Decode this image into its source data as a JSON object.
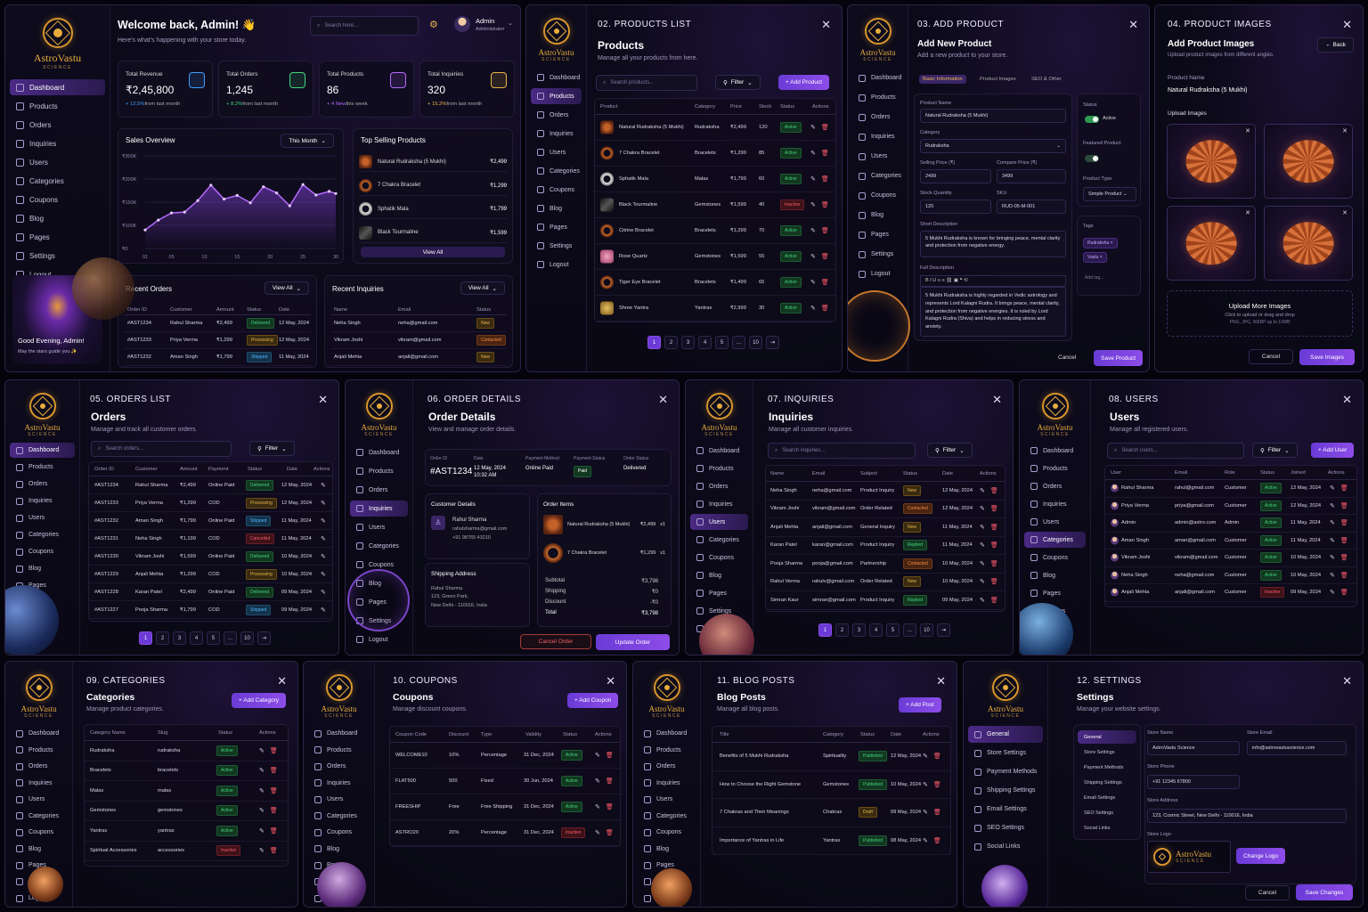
{
  "brand": {
    "name": "AstroVastu",
    "sub": "SCIENCE"
  },
  "nav": [
    "Dashboard",
    "Products",
    "Orders",
    "Inquiries",
    "Users",
    "Categories",
    "Coupons",
    "Blog",
    "Pages",
    "Settings",
    "Logout"
  ],
  "dash": {
    "welcome": "Welcome back, Admin! 👋",
    "tagline": "Here's what's happening with your store today.",
    "search": "Search here...",
    "user": "Admin",
    "role": "Administrator",
    "stats": [
      {
        "label": "Total Revenue",
        "value": "₹2,45,800",
        "delta": "+ 12.5%",
        "note": "from last month",
        "color": "#3fa0ff"
      },
      {
        "label": "Total Orders",
        "value": "1,245",
        "delta": "+ 8.2%",
        "note": "from last month",
        "color": "#3fd77b"
      },
      {
        "label": "Total Products",
        "value": "86",
        "delta": "+ 4 New",
        "note": "this week",
        "color": "#b36bff"
      },
      {
        "label": "Total Inquiries",
        "value": "320",
        "delta": "+ 15.2%",
        "note": "from last month",
        "color": "#e8b54a"
      }
    ],
    "sales": {
      "title": "Sales Overview",
      "range": "This Month"
    },
    "top": {
      "title": "Top Selling Products",
      "items": [
        {
          "name": "Natural Rudraksha (5 Mukhi)",
          "price": "₹2,499"
        },
        {
          "name": "7 Chakra Bracelet",
          "price": "₹1,299"
        },
        {
          "name": "Sphatik Mala",
          "price": "₹1,799"
        },
        {
          "name": "Black Tourmaline",
          "price": "₹1,599"
        }
      ],
      "view": "View All"
    },
    "recent_orders": {
      "title": "Recent Orders",
      "view": "View All",
      "cols": [
        "Order ID",
        "Customer",
        "Amount",
        "Status",
        "Date"
      ],
      "rows": [
        [
          "#AST1234",
          "Rahul Sharma",
          "₹2,499",
          "Delivered",
          "12 May, 2024"
        ],
        [
          "#AST1233",
          "Priya Verma",
          "₹1,299",
          "Processing",
          "12 May, 2024"
        ],
        [
          "#AST1232",
          "Aman Singh",
          "₹1,799",
          "Shipped",
          "11 May, 2024"
        ]
      ]
    },
    "recent_inq": {
      "title": "Recent Inquiries",
      "view": "View All",
      "cols": [
        "Name",
        "Email",
        "Status"
      ],
      "rows": [
        [
          "Neha Singh",
          "neha@gmail.com",
          "New"
        ],
        [
          "Vikram Joshi",
          "vikram@gmail.com",
          "Contacted"
        ],
        [
          "Anjali Mehta",
          "anjali@gmail.com",
          "New"
        ]
      ]
    },
    "greet": "Good Evening, Admin!",
    "greet_sub": "May the stars guide you ✨"
  },
  "chart_data": {
    "type": "area",
    "x": [
      1,
      3,
      5,
      7,
      9,
      11,
      13,
      15,
      17,
      19,
      21,
      23,
      25,
      27,
      29,
      30
    ],
    "values": [
      60,
      92,
      115,
      118,
      155,
      205,
      160,
      172,
      148,
      200,
      180,
      138,
      207,
      173,
      185,
      178
    ],
    "ylim": [
      0,
      300
    ],
    "xticks": [
      "01",
      "05",
      "10",
      "15",
      "20",
      "25",
      "30"
    ],
    "yticks": [
      "₹300K",
      "₹200K",
      "₹150K",
      "₹100K",
      "₹0"
    ]
  },
  "p02": {
    "title": "02. PRODUCTS LIST",
    "h": "Products",
    "sub": "Manage all your products from here.",
    "search": "Search products...",
    "filter": "Filter",
    "add": "+ Add Product",
    "cols": [
      "Product",
      "Category",
      "Price",
      "Stock",
      "Status",
      "Actions"
    ],
    "rows": [
      [
        "Natural Rudraksha (5 Mukhi)",
        "Rudraksha",
        "₹2,499",
        "120",
        "Active",
        "rudra"
      ],
      [
        "7 Chakra Bracelet",
        "Bracelets",
        "₹1,299",
        "85",
        "Active",
        "ring"
      ],
      [
        "Sphatik Mala",
        "Malas",
        "₹1,799",
        "60",
        "Active",
        "white"
      ],
      [
        "Black Tourmaline",
        "Gemstones",
        "₹1,599",
        "40",
        "Inactive",
        "black"
      ],
      [
        "Citrine Bracelet",
        "Bracelets",
        "₹1,299",
        "70",
        "Active",
        "ring"
      ],
      [
        "Rose Quartz",
        "Gemstones",
        "₹1,599",
        "55",
        "Active",
        "pink"
      ],
      [
        "Tiger Eye Bracelet",
        "Bracelets",
        "₹1,499",
        "65",
        "Active",
        "ring"
      ],
      [
        "Shree Yantra",
        "Yantras",
        "₹2,999",
        "30",
        "Active",
        "gold"
      ]
    ],
    "pages": [
      "1",
      "2",
      "3",
      "4",
      "5",
      "...",
      "10",
      "⇥"
    ]
  },
  "p03": {
    "title": "03. ADD PRODUCT",
    "h": "Add New Product",
    "sub": "Add a new product to your store.",
    "tabs": [
      "Basic Information",
      "Product Images",
      "SEO & Other"
    ],
    "fields": {
      "name_l": "Product Name",
      "name": "Natural Rudraksha (5 Mukhi)",
      "cat_l": "Category",
      "cat": "Rudraksha",
      "sp_l": "Selling Price (₹)",
      "sp": "2499",
      "cp_l": "Compare Price (₹)",
      "cp": "3499",
      "stock_l": "Stock Quantity",
      "stock": "120",
      "sku_l": "SKU",
      "sku": "RUD-05-M-001",
      "short_l": "Short Description",
      "short": "5 Mukhi Rudraksha is known for bringing peace, mental clarity and protection from negative energy.",
      "full_l": "Full Description",
      "full": "5 Mukhi Rudraksha is highly regarded in Vedic astrology and represents Lord Kalagni Rudra. It brings peace, mental clarity, and protection from negative energies. It is ruled by Lord Kalagni Rudra (Shiva) and helps in reducing stress and anxiety."
    },
    "status_l": "Status",
    "status": "Active",
    "featured_l": "Featured Product",
    "type_l": "Product Type",
    "type": "Simple Product",
    "tags_l": "Tags",
    "tags": [
      "Rudraksha ×",
      "Vastu ×"
    ],
    "tag_ph": "Add tag...",
    "cancel": "Cancel",
    "save": "Save Product"
  },
  "p04": {
    "title": "04. PRODUCT IMAGES",
    "back": "← Back",
    "h": "Add Product Images",
    "sub": "Upload product images from different angles.",
    "name_l": "Product Name",
    "name": "Natural Rudraksha (5 Mukhi)",
    "upload_l": "Upload Images",
    "more": "Upload More Images",
    "more_sub": "Click to upload or drag and drop",
    "fmt": "PNG, JPG, WEBP up to 10MB",
    "cancel": "Cancel",
    "save": "Save Images"
  },
  "p05": {
    "title": "05. ORDERS LIST",
    "h": "Orders",
    "sub": "Manage and track all customer orders.",
    "search": "Search orders...",
    "filter": "Filter",
    "cols": [
      "Order ID",
      "Customer",
      "Amount",
      "Payment",
      "Status",
      "Date",
      "Actions"
    ],
    "rows": [
      [
        "#AST1234",
        "Rahul Sharma",
        "₹2,499",
        "Online Paid",
        "Delivered",
        "12 May, 2024"
      ],
      [
        "#AST1233",
        "Priya Verma",
        "₹1,299",
        "COD",
        "Processing",
        "12 May, 2024"
      ],
      [
        "#AST1232",
        "Aman Singh",
        "₹1,799",
        "Online Paid",
        "Shipped",
        "11 May, 2024"
      ],
      [
        "#AST1231",
        "Neha Singh",
        "₹1,199",
        "COD",
        "Cancelled",
        "11 May, 2024"
      ],
      [
        "#AST1230",
        "Vikram Joshi",
        "₹1,599",
        "Online Paid",
        "Delivered",
        "10 May, 2024"
      ],
      [
        "#AST1229",
        "Anjali Mehta",
        "₹1,299",
        "COD",
        "Processing",
        "10 May, 2024"
      ],
      [
        "#AST1228",
        "Karan Patel",
        "₹2,499",
        "Online Paid",
        "Delivered",
        "09 May, 2024"
      ],
      [
        "#AST1227",
        "Pooja Sharma",
        "₹1,799",
        "COD",
        "Shipped",
        "09 May, 2024"
      ]
    ],
    "pages": [
      "1",
      "2",
      "3",
      "4",
      "5",
      "...",
      "10",
      "⇥"
    ]
  },
  "p06": {
    "title": "06. ORDER DETAILS",
    "h": "Order Details",
    "sub": "View and manage order details.",
    "summary": [
      [
        "Order ID",
        "#AST1234"
      ],
      [
        "Date",
        "12 May, 2024\n10:32 AM"
      ],
      [
        "Payment Method",
        "Online Paid"
      ],
      [
        "Payment Status",
        "Paid"
      ],
      [
        "Order Status",
        "Delivered"
      ]
    ],
    "cust_t": "Customer Details",
    "cust_name": "Rahul Sharma",
    "cust_email": "rahulsharma@gmail.com",
    "cust_phone": "+91 98765 43210",
    "items_t": "Order Items",
    "items": [
      [
        "Natural Rudraksha (5 Mukhi)",
        "₹2,499",
        "x1"
      ],
      [
        "7 Chakra Bracelet",
        "₹1,299",
        "x1"
      ]
    ],
    "ship_t": "Shipping Address",
    "ship": [
      "Rahul Sharma",
      "123, Green Park,",
      "New Delhi - 110016, India"
    ],
    "totals": [
      [
        "Subtotal",
        "₹3,798"
      ],
      [
        "Shipping",
        "₹0"
      ],
      [
        "Discount",
        "-₹0"
      ],
      [
        "Total",
        "₹3,798"
      ]
    ],
    "cancel": "Cancel Order",
    "update": "Update Order"
  },
  "p07": {
    "title": "07. INQUIRIES",
    "h": "Inquiries",
    "sub": "Manage all customer inquiries.",
    "search": "Search inquiries...",
    "filter": "Filter",
    "cols": [
      "Name",
      "Email",
      "Subject",
      "Status",
      "Date",
      "Actions"
    ],
    "rows": [
      [
        "Neha Singh",
        "neha@gmail.com",
        "Product Inquiry",
        "New",
        "12 May, 2024"
      ],
      [
        "Vikram Joshi",
        "vikram@gmail.com",
        "Order Related",
        "Contacted",
        "12 May, 2024"
      ],
      [
        "Anjali Mehta",
        "anjali@gmail.com",
        "General Inquiry",
        "New",
        "11 May, 2024"
      ],
      [
        "Karan Patel",
        "karan@gmail.com",
        "Product Inquiry",
        "Replied",
        "11 May, 2024"
      ],
      [
        "Pooja Sharma",
        "pooja@gmail.com",
        "Partnership",
        "Contacted",
        "10 May, 2024"
      ],
      [
        "Rahul Verma",
        "rahulv@gmail.com",
        "Order Related",
        "New",
        "10 May, 2024"
      ],
      [
        "Simran Kaur",
        "simran@gmail.com",
        "Product Inquiry",
        "Replied",
        "09 May, 2024"
      ]
    ],
    "pages": [
      "1",
      "2",
      "3",
      "4",
      "5",
      "...",
      "10",
      "⇥"
    ]
  },
  "p08": {
    "title": "08. USERS",
    "h": "Users",
    "sub": "Manage all registered users.",
    "search": "Search users...",
    "filter": "Filter",
    "add": "+ Add User",
    "cols": [
      "User",
      "Email",
      "Role",
      "Status",
      "Joined",
      "Actions"
    ],
    "rows": [
      [
        "Rahul Sharma",
        "rahul@gmail.com",
        "Customer",
        "Active",
        "12 May, 2024"
      ],
      [
        "Priya Verma",
        "priya@gmail.com",
        "Customer",
        "Active",
        "12 May, 2024"
      ],
      [
        "Admin",
        "admin@astro.com",
        "Admin",
        "Active",
        "11 May, 2024"
      ],
      [
        "Aman Singh",
        "aman@gmail.com",
        "Customer",
        "Active",
        "11 May, 2024"
      ],
      [
        "Vikram Joshi",
        "vikram@gmail.com",
        "Customer",
        "Active",
        "10 May, 2024"
      ],
      [
        "Neha Singh",
        "neha@gmail.com",
        "Customer",
        "Active",
        "10 May, 2024"
      ],
      [
        "Anjali Mehta",
        "anjali@gmail.com",
        "Customer",
        "Inactive",
        "09 May, 2024"
      ]
    ]
  },
  "p09": {
    "title": "09. CATEGORIES",
    "h": "Categories",
    "sub": "Manage product categories.",
    "add": "+ Add Category",
    "cols": [
      "Category Name",
      "Slug",
      "Status",
      "Actions"
    ],
    "rows": [
      [
        "Rudraksha",
        "rudraksha",
        "Active"
      ],
      [
        "Bracelets",
        "bracelets",
        "Active"
      ],
      [
        "Malas",
        "malas",
        "Active"
      ],
      [
        "Gemstones",
        "gemstones",
        "Active"
      ],
      [
        "Yantras",
        "yantras",
        "Active"
      ],
      [
        "Spiritual Accessories",
        "accessories",
        "Inactive"
      ]
    ]
  },
  "p10": {
    "title": "10. COUPONS",
    "h": "Coupons",
    "sub": "Manage discount coupons.",
    "add": "+ Add Coupon",
    "cols": [
      "Coupon Code",
      "Discount",
      "Type",
      "Validity",
      "Status",
      "Actions"
    ],
    "rows": [
      [
        "WELCOME10",
        "10%",
        "Percentage",
        "31 Dec, 2024",
        "Active"
      ],
      [
        "FLAT500",
        "500",
        "Fixed",
        "30 Jun, 2024",
        "Active"
      ],
      [
        "FREESHIP",
        "Free",
        "Free Shipping",
        "31 Dec, 2024",
        "Active"
      ],
      [
        "ASTRO20",
        "20%",
        "Percentage",
        "31 Dec, 2024",
        "Inactive"
      ]
    ]
  },
  "p11": {
    "title": "11. BLOG POSTS",
    "h": "Blog Posts",
    "sub": "Manage all blog posts.",
    "add": "+ Add Post",
    "cols": [
      "Title",
      "Category",
      "Status",
      "Date",
      "Actions"
    ],
    "rows": [
      [
        "Benefits of 5 Mukhi Rudraksha",
        "Spirituality",
        "Published",
        "12 May, 2024"
      ],
      [
        "How to Choose the Right Gemstone",
        "Gemstones",
        "Published",
        "10 May, 2024"
      ],
      [
        "7 Chakras and Their Meanings",
        "Chakras",
        "Draft",
        "09 May, 2024"
      ],
      [
        "Importance of Yantras in Life",
        "Yantras",
        "Published",
        "08 May, 2024"
      ]
    ]
  },
  "p12": {
    "title": "12. SETTINGS",
    "h": "Settings",
    "sub": "Manage your website settings.",
    "menu": [
      "General",
      "Store Settings",
      "Payment Methods",
      "Shipping Settings",
      "Email Settings",
      "SEO Settings",
      "Social Links"
    ],
    "store_name_l": "Store Name",
    "store_name": "AstroVastu Science",
    "store_email_l": "Store Email",
    "store_email": "info@astrovastuscience.com",
    "phone_l": "Store Phone",
    "phone": "+91 12345 67800",
    "addr_l": "Store Address",
    "addr": "123, Cosmic Street, New Delhi - 110016, India",
    "logo_l": "Store Logo",
    "change": "Change Logo",
    "cancel": "Cancel",
    "save": "Save Changes"
  }
}
